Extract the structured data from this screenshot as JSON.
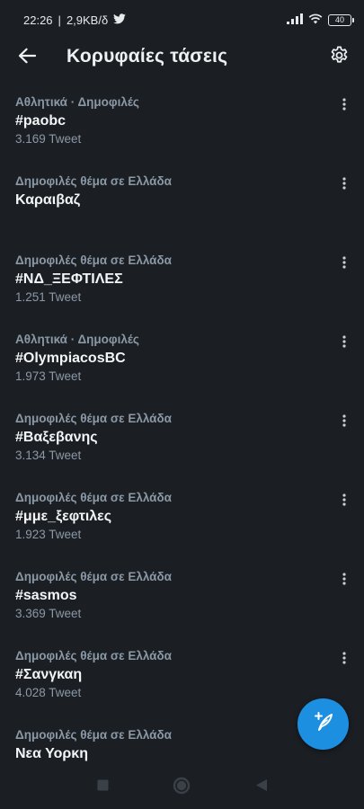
{
  "status_bar": {
    "time": "22:26",
    "network_speed": "2,9KB/δ",
    "battery": "40",
    "icons": [
      "twitter-bird-icon",
      "signal-icon",
      "wifi-icon",
      "battery-icon"
    ]
  },
  "header": {
    "title": "Κορυφαίες τάσεις",
    "back_icon": "arrow-left-icon",
    "settings_icon": "gear-icon"
  },
  "trends": [
    {
      "context": "Αθλητικά · Δημοφιλές",
      "name": "#paobc",
      "count": "3.169 Tweet"
    },
    {
      "context": "Δημοφιλές θέμα σε Ελλάδα",
      "name": "Καραιβαζ",
      "count": ""
    },
    {
      "context": "Δημοφιλές θέμα σε Ελλάδα",
      "name": "#ΝΔ_ΞΕΦΤΙΛΕΣ",
      "count": "1.251 Tweet"
    },
    {
      "context": "Αθλητικά · Δημοφιλές",
      "name": "#OlympiacosBC",
      "count": "1.973 Tweet"
    },
    {
      "context": "Δημοφιλές θέμα σε Ελλάδα",
      "name": "#Βαξεβανης",
      "count": "3.134 Tweet"
    },
    {
      "context": "Δημοφιλές θέμα σε Ελλάδα",
      "name": "#μμε_ξεφτιλες",
      "count": "1.923 Tweet"
    },
    {
      "context": "Δημοφιλές θέμα σε Ελλάδα",
      "name": "#sasmos",
      "count": "3.369 Tweet"
    },
    {
      "context": "Δημοφιλές θέμα σε Ελλάδα",
      "name": "#Σανγκαη",
      "count": "4.028 Tweet"
    },
    {
      "context": "Δημοφιλές θέμα σε Ελλάδα",
      "name": "Νεα Υορκη",
      "count": ""
    }
  ],
  "fab": {
    "icon": "compose-tweet-icon",
    "color": "#1d8fe0"
  },
  "nav_bar": {
    "icons": [
      "recents-square-icon",
      "home-circle-icon",
      "back-triangle-icon"
    ]
  },
  "colors": {
    "background": "#1b1f24",
    "secondary_text": "#8b98a5",
    "primary_text": "#f3f5f6",
    "accent": "#1d8fe0"
  }
}
